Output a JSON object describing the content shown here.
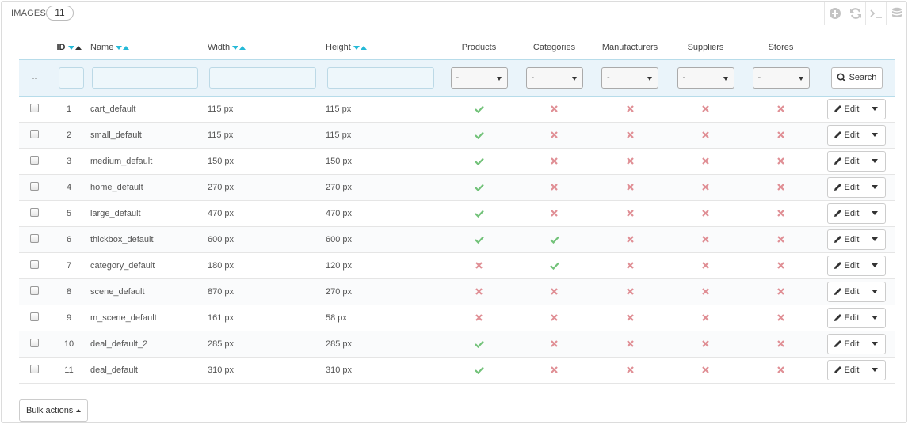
{
  "panel": {
    "title": "IMAGES",
    "count": "11"
  },
  "toolbar": [
    {
      "name": "add-new-button",
      "icon": "plus-circle-icon"
    },
    {
      "name": "refresh-list-button",
      "icon": "refresh-icon"
    },
    {
      "name": "show-sql-button",
      "icon": "terminal-icon"
    },
    {
      "name": "export-sql-button",
      "icon": "database-icon"
    }
  ],
  "columns": {
    "id": "ID",
    "name": "Name",
    "width": "Width",
    "height": "Height",
    "products": "Products",
    "categories": "Categories",
    "manufacturers": "Manufacturers",
    "suppliers": "Suppliers",
    "stores": "Stores"
  },
  "filters": {
    "bulk_placeholder": "--",
    "select_value": "-",
    "search_label": "Search"
  },
  "rows": [
    {
      "id": "1",
      "name": "cart_default",
      "width": "115 px",
      "height": "115 px",
      "products": true,
      "categories": false,
      "manufacturers": false,
      "suppliers": false,
      "stores": false
    },
    {
      "id": "2",
      "name": "small_default",
      "width": "115 px",
      "height": "115 px",
      "products": true,
      "categories": false,
      "manufacturers": false,
      "suppliers": false,
      "stores": false
    },
    {
      "id": "3",
      "name": "medium_default",
      "width": "150 px",
      "height": "150 px",
      "products": true,
      "categories": false,
      "manufacturers": false,
      "suppliers": false,
      "stores": false
    },
    {
      "id": "4",
      "name": "home_default",
      "width": "270 px",
      "height": "270 px",
      "products": true,
      "categories": false,
      "manufacturers": false,
      "suppliers": false,
      "stores": false
    },
    {
      "id": "5",
      "name": "large_default",
      "width": "470 px",
      "height": "470 px",
      "products": true,
      "categories": false,
      "manufacturers": false,
      "suppliers": false,
      "stores": false
    },
    {
      "id": "6",
      "name": "thickbox_default",
      "width": "600 px",
      "height": "600 px",
      "products": true,
      "categories": true,
      "manufacturers": false,
      "suppliers": false,
      "stores": false
    },
    {
      "id": "7",
      "name": "category_default",
      "width": "180 px",
      "height": "120 px",
      "products": false,
      "categories": true,
      "manufacturers": false,
      "suppliers": false,
      "stores": false
    },
    {
      "id": "8",
      "name": "scene_default",
      "width": "870 px",
      "height": "270 px",
      "products": false,
      "categories": false,
      "manufacturers": false,
      "suppliers": false,
      "stores": false
    },
    {
      "id": "9",
      "name": "m_scene_default",
      "width": "161 px",
      "height": "58 px",
      "products": false,
      "categories": false,
      "manufacturers": false,
      "suppliers": false,
      "stores": false
    },
    {
      "id": "10",
      "name": "deal_default_2",
      "width": "285 px",
      "height": "285 px",
      "products": true,
      "categories": false,
      "manufacturers": false,
      "suppliers": false,
      "stores": false
    },
    {
      "id": "11",
      "name": "deal_default",
      "width": "310 px",
      "height": "310 px",
      "products": true,
      "categories": false,
      "manufacturers": false,
      "suppliers": false,
      "stores": false
    }
  ],
  "row_action": {
    "edit_label": "Edit"
  },
  "bulk": {
    "label": "Bulk actions"
  },
  "colors": {
    "accent": "#25b9d7",
    "check": "#72c279",
    "cross": "#e08f95",
    "filter_bg": "#eaf4fa"
  }
}
